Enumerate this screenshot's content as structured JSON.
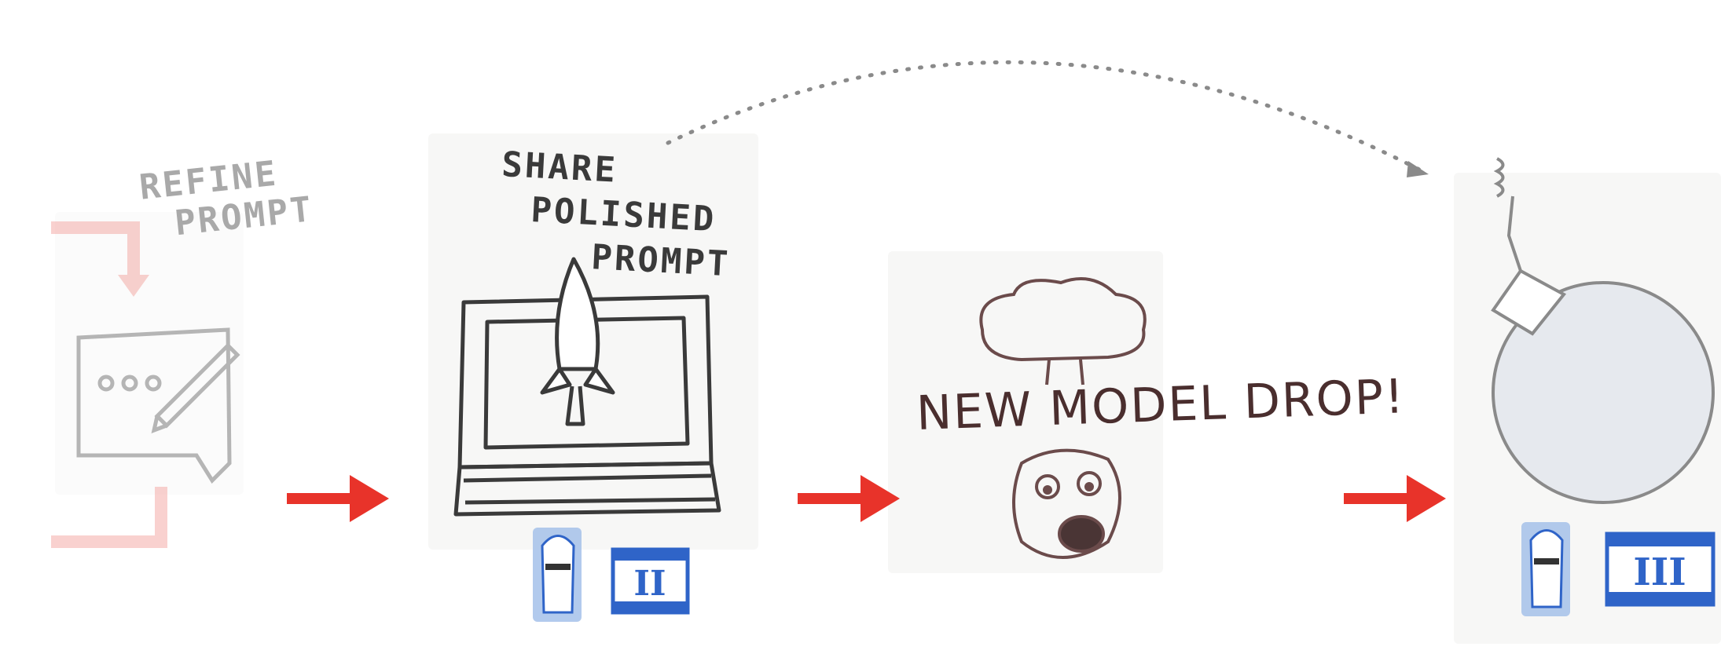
{
  "steps": [
    {
      "label_line1": "REFINE",
      "label_line2": "PROMPT"
    },
    {
      "label_line1": "SHARE",
      "label_line2": "POLISHED",
      "label_line3": "PROMPT",
      "badge": "II"
    },
    {
      "label": "NEW MODEL DROP!"
    },
    {
      "badge": "III"
    }
  ],
  "colors": {
    "arrow": "#e8332a",
    "pencil_dark": "#3a3a3a",
    "pencil_light": "#b5b5b5",
    "badge_blue": "#2f64c8",
    "dotted_arc": "#8a8a8a"
  },
  "icons": [
    "chat-bubble-icon",
    "pencil-icon",
    "laptop-icon",
    "rocket-icon",
    "mushroom-cloud-icon",
    "surprised-face-icon",
    "bomb-icon",
    "llama-icon"
  ]
}
